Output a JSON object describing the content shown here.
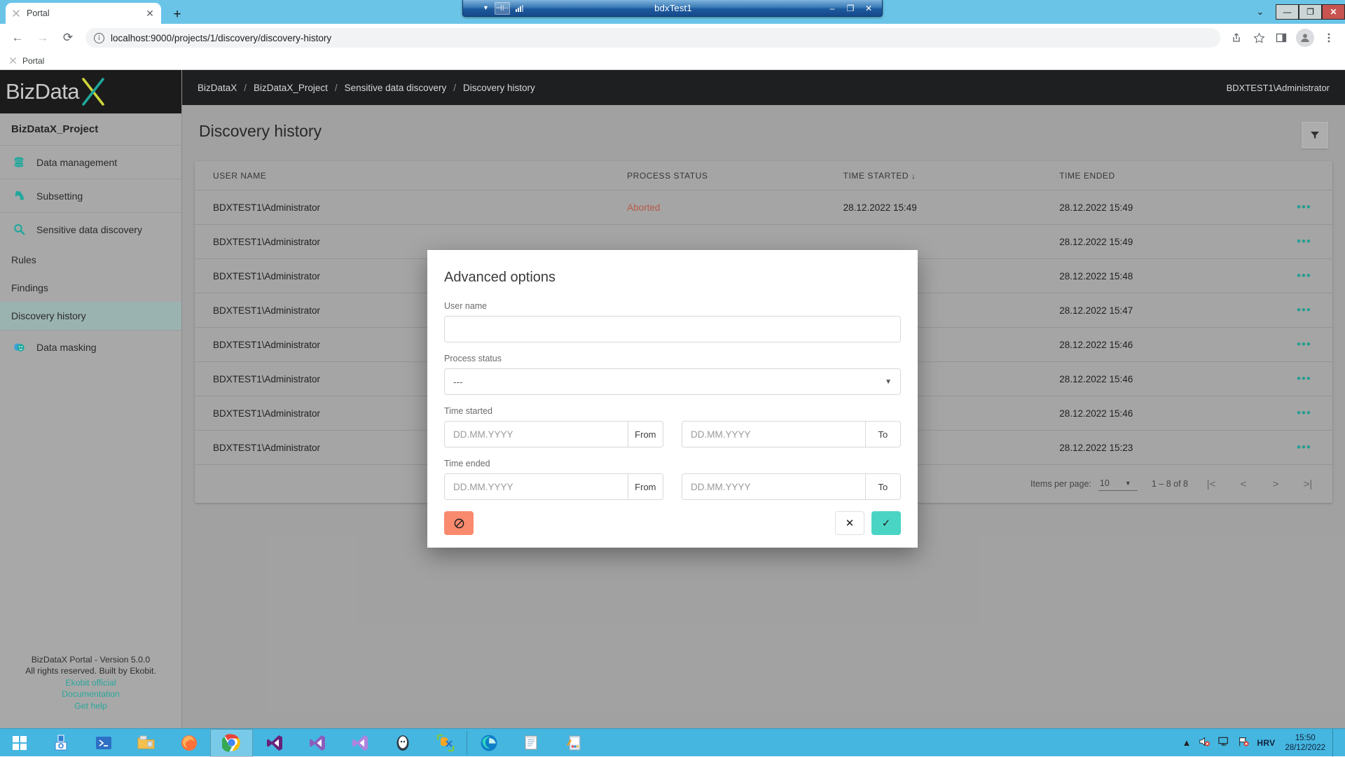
{
  "rdp": {
    "title": "bdxTest1",
    "chevron_icon": "chevron-down-icon",
    "pin_icon": "pin-icon",
    "signal_icon": "signal-strength-icon",
    "minimize": "–",
    "restore": "❐",
    "close": "✕"
  },
  "browser": {
    "tab": {
      "title": "Portal",
      "favicon": "bizdatax-favicon",
      "close": "✕"
    },
    "new_tab": "+",
    "tabstrip_chevron": "⌄",
    "window_buttons": {
      "minimize": "—",
      "maximize": "❐",
      "close": "✕"
    },
    "nav": {
      "back": "←",
      "forward": "→",
      "reload": "⟳"
    },
    "omnibox": {
      "site_info_icon": "site-info-icon",
      "url": "localhost:9000/projects/1/discovery/discovery-history"
    },
    "toolbar_icons": {
      "share": "share-icon",
      "bookmark": "star-icon",
      "sidepanel": "side-panel-icon",
      "profile": "profile-avatar-icon",
      "menu": "kebab-menu-icon"
    },
    "bookmark": {
      "label": "Portal",
      "favicon": "bizdatax-favicon"
    }
  },
  "sidebar": {
    "logo": {
      "text": "BizData",
      "mark": "X"
    },
    "project_name": "BizDataX_Project",
    "items": [
      {
        "label": "Data management",
        "icon": "database-icon"
      },
      {
        "label": "Subsetting",
        "icon": "puzzle-piece-icon"
      },
      {
        "label": "Sensitive data discovery",
        "icon": "magnifier-icon"
      }
    ],
    "sub_items": [
      {
        "label": "Rules",
        "active": false
      },
      {
        "label": "Findings",
        "active": false
      },
      {
        "label": "Discovery history",
        "active": true
      }
    ],
    "items_after": [
      {
        "label": "Data masking",
        "icon": "theater-masks-icon"
      }
    ],
    "footer": {
      "version": "BizDataX Portal - Version 5.0.0",
      "rights": "All rights reserved. Built by Ekobit.",
      "links": [
        "Ekobit official",
        "Documentation",
        "Get help"
      ]
    }
  },
  "topbar": {
    "breadcrumb": [
      "BizDataX",
      "BizDataX_Project",
      "Sensitive data discovery",
      "Discovery history"
    ],
    "separator": "/",
    "user": "BDXTEST1\\Administrator"
  },
  "page": {
    "title": "Discovery history",
    "filter_button_icon": "filter-funnel-icon"
  },
  "table": {
    "columns": [
      "USER NAME",
      "PROCESS STATUS",
      "TIME STARTED",
      "TIME ENDED"
    ],
    "sort_column": "TIME STARTED",
    "sort_arrow": "↓",
    "row_menu_icon": "more-options-icon",
    "rows": [
      {
        "user": "BDXTEST1\\Administrator",
        "status": "Aborted",
        "started": "28.12.2022 15:49",
        "ended": "28.12.2022 15:49",
        "menu": "•••"
      },
      {
        "user": "BDXTEST1\\Administrator",
        "status": "",
        "started": "",
        "ended": "28.12.2022 15:49",
        "menu": "•••"
      },
      {
        "user": "BDXTEST1\\Administrator",
        "status": "",
        "started": "",
        "ended": "28.12.2022 15:48",
        "menu": "•••"
      },
      {
        "user": "BDXTEST1\\Administrator",
        "status": "",
        "started": "",
        "ended": "28.12.2022 15:47",
        "menu": "•••"
      },
      {
        "user": "BDXTEST1\\Administrator",
        "status": "",
        "started": "",
        "ended": "28.12.2022 15:46",
        "menu": "•••"
      },
      {
        "user": "BDXTEST1\\Administrator",
        "status": "",
        "started": "",
        "ended": "28.12.2022 15:46",
        "menu": "•••"
      },
      {
        "user": "BDXTEST1\\Administrator",
        "status": "",
        "started": "",
        "ended": "28.12.2022 15:46",
        "menu": "•••"
      },
      {
        "user": "BDXTEST1\\Administrator",
        "status": "",
        "started": "",
        "ended": "28.12.2022 15:23",
        "menu": "•••"
      }
    ]
  },
  "paginator": {
    "items_per_page_label": "Items per page:",
    "items_per_page_value": "10",
    "caret": "▼",
    "range": "1 – 8 of 8",
    "first": "|<",
    "prev": "<",
    "next": ">",
    "last": ">|"
  },
  "dialog": {
    "title": "Advanced options",
    "user_name": {
      "label": "User name",
      "value": "",
      "placeholder": ""
    },
    "process_status": {
      "label": "Process status",
      "value": "---",
      "caret": "▼"
    },
    "time_started": {
      "label": "Time started",
      "from": {
        "placeholder": "DD.MM.YYYY",
        "value": "",
        "suffix": "From"
      },
      "to": {
        "placeholder": "DD.MM.YYYY",
        "value": "",
        "suffix": "To"
      }
    },
    "time_ended": {
      "label": "Time ended",
      "from": {
        "placeholder": "DD.MM.YYYY",
        "value": "",
        "suffix": "From"
      },
      "to": {
        "placeholder": "DD.MM.YYYY",
        "value": "",
        "suffix": "To"
      }
    },
    "buttons": {
      "clear_icon": "block-clear-icon",
      "clear_glyph": "🚫",
      "cancel_glyph": "✕",
      "apply_glyph": "✓"
    },
    "colors": {
      "clear": "#f98a6e",
      "apply": "#4ad4c4"
    }
  },
  "taskbar": {
    "start_icon": "windows-start-icon",
    "apps": [
      {
        "icon": "server-manager-icon",
        "name": "server-manager"
      },
      {
        "icon": "powershell-icon",
        "name": "powershell"
      },
      {
        "icon": "file-explorer-icon",
        "name": "file-explorer"
      },
      {
        "icon": "firefox-icon",
        "name": "firefox"
      },
      {
        "icon": "chrome-icon",
        "name": "chrome",
        "active": true
      },
      {
        "icon": "visual-studio-icon",
        "name": "visual-studio"
      },
      {
        "icon": "vs-code-icon",
        "name": "vs-code-blue"
      },
      {
        "icon": "visual-studio-purple-icon",
        "name": "visual-studio-purple"
      },
      {
        "icon": "ghost-icon",
        "name": "ghostdoc"
      },
      {
        "icon": "bizdatax-icon",
        "name": "bizdatax-tool"
      },
      {
        "icon": "edge-icon",
        "name": "microsoft-edge"
      },
      {
        "icon": "notepad-icon",
        "name": "notepad"
      },
      {
        "icon": "paint-icon",
        "name": "paint"
      }
    ],
    "tray": {
      "expand": "▲",
      "volume_icon": "volume-muted-icon",
      "network_icon": "network-icon",
      "flag_icon": "action-center-flag-icon",
      "language": "HRV",
      "time": "15:50",
      "date": "28/12/2022"
    }
  },
  "colors": {
    "accent_teal": "#2aa79b",
    "aborted_red": "#c3614f",
    "sidebar_bg": "#a8a8a8",
    "topbar_bg": "#1d1f21",
    "taskbar_blue": "#45b6e0"
  }
}
